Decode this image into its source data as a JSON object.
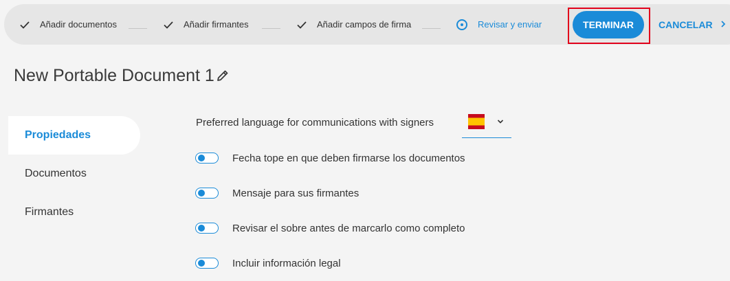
{
  "stepper": {
    "steps": [
      {
        "label": "Añadir documentos",
        "state": "done"
      },
      {
        "label": "Añadir firmantes",
        "state": "done"
      },
      {
        "label": "Añadir campos de firma",
        "state": "done"
      },
      {
        "label": "Revisar y enviar",
        "state": "current"
      }
    ],
    "finish_label": "TERMINAR",
    "cancel_label": "CANCELAR"
  },
  "document": {
    "title": "New Portable Document 1"
  },
  "sidebar": {
    "items": [
      {
        "label": "Propiedades",
        "active": true
      },
      {
        "label": "Documentos",
        "active": false
      },
      {
        "label": "Firmantes",
        "active": false
      }
    ]
  },
  "properties": {
    "language_label": "Preferred language for communications with signers",
    "language_flag": "spain-flag",
    "toggles": [
      {
        "label": "Fecha tope en que deben firmarse los documentos"
      },
      {
        "label": "Mensaje para sus firmantes"
      },
      {
        "label": "Revisar el sobre antes de marcarlo como completo"
      },
      {
        "label": "Incluir información legal"
      }
    ]
  },
  "colors": {
    "accent": "#1a8bd8",
    "highlight": "#e2001a"
  }
}
